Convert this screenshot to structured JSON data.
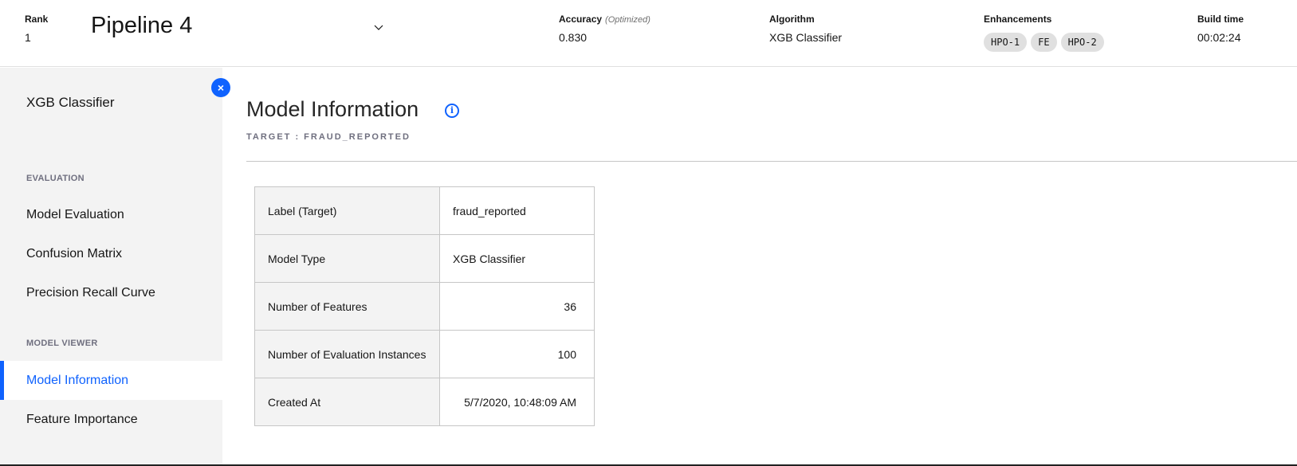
{
  "header": {
    "rank_label": "Rank",
    "rank_value": "1",
    "pipeline_title": "Pipeline 4",
    "accuracy_label": "Accuracy",
    "accuracy_note": "(Optimized)",
    "accuracy_value": "0.830",
    "algorithm_label": "Algorithm",
    "algorithm_value": "XGB Classifier",
    "enhancements_label": "Enhancements",
    "enhancements": [
      "HPO-1",
      "FE",
      "HPO-2"
    ],
    "build_time_label": "Build time",
    "build_time_value": "00:02:24"
  },
  "sidebar": {
    "title": "XGB Classifier",
    "sections": [
      {
        "label": "EVALUATION",
        "items": [
          "Model Evaluation",
          "Confusion Matrix",
          "Precision Recall Curve"
        ]
      },
      {
        "label": "MODEL VIEWER",
        "items": [
          "Model Information",
          "Feature Importance"
        ]
      }
    ],
    "active_item": "Model Information"
  },
  "main": {
    "title": "Model Information",
    "target": "TARGET : FRAUD_REPORTED",
    "rows": [
      {
        "key": "Label (Target)",
        "value": "fraud_reported"
      },
      {
        "key": "Model Type",
        "value": "XGB Classifier"
      },
      {
        "key": "Number of Features",
        "value": "36"
      },
      {
        "key": "Number of Evaluation Instances",
        "value": "100"
      },
      {
        "key": "Created At",
        "value": "5/7/2020, 10:48:09 AM"
      }
    ]
  },
  "colors": {
    "accent": "#0f62fe",
    "sidebar_bg": "#f3f3f3"
  }
}
